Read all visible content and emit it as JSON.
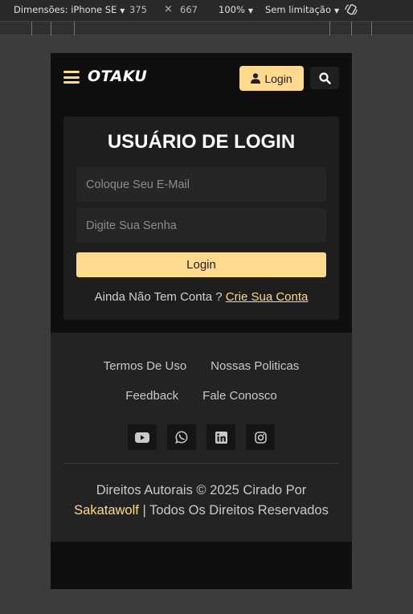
{
  "devtools": {
    "dimensions_label": "Dimensões: iPhone SE",
    "width": "375",
    "times": "×",
    "height": "667",
    "zoom": "100%",
    "throttle": "Sem limitação"
  },
  "navbar": {
    "brand": "OTAKU",
    "login_label": "Login"
  },
  "login": {
    "title": "USUÁRIO DE LOGIN",
    "email_placeholder": "Coloque Seu E-Mail",
    "password_placeholder": "Digite Sua Senha",
    "submit_label": "Login",
    "signup_prompt": "Ainda Não Tem Conta ?",
    "signup_link": "Crie Sua Conta"
  },
  "footer": {
    "links_row1": [
      "Termos De Uso",
      "Nossas Politicas"
    ],
    "links_row2": [
      "Feedback",
      "Fale Conosco"
    ],
    "socials": [
      "youtube-icon",
      "whatsapp-icon",
      "linkedin-icon",
      "instagram-icon"
    ],
    "copyright_line1": "Direitos Autorais © 2025 Cirado Por",
    "author": "Sakatawolf",
    "copyright_line2": " | Todos Os Direitos Reservados"
  },
  "colors": {
    "accent": "#ffd98e",
    "background": "#0f0f0f",
    "card": "#1e1e1e",
    "footer": "#232323"
  }
}
